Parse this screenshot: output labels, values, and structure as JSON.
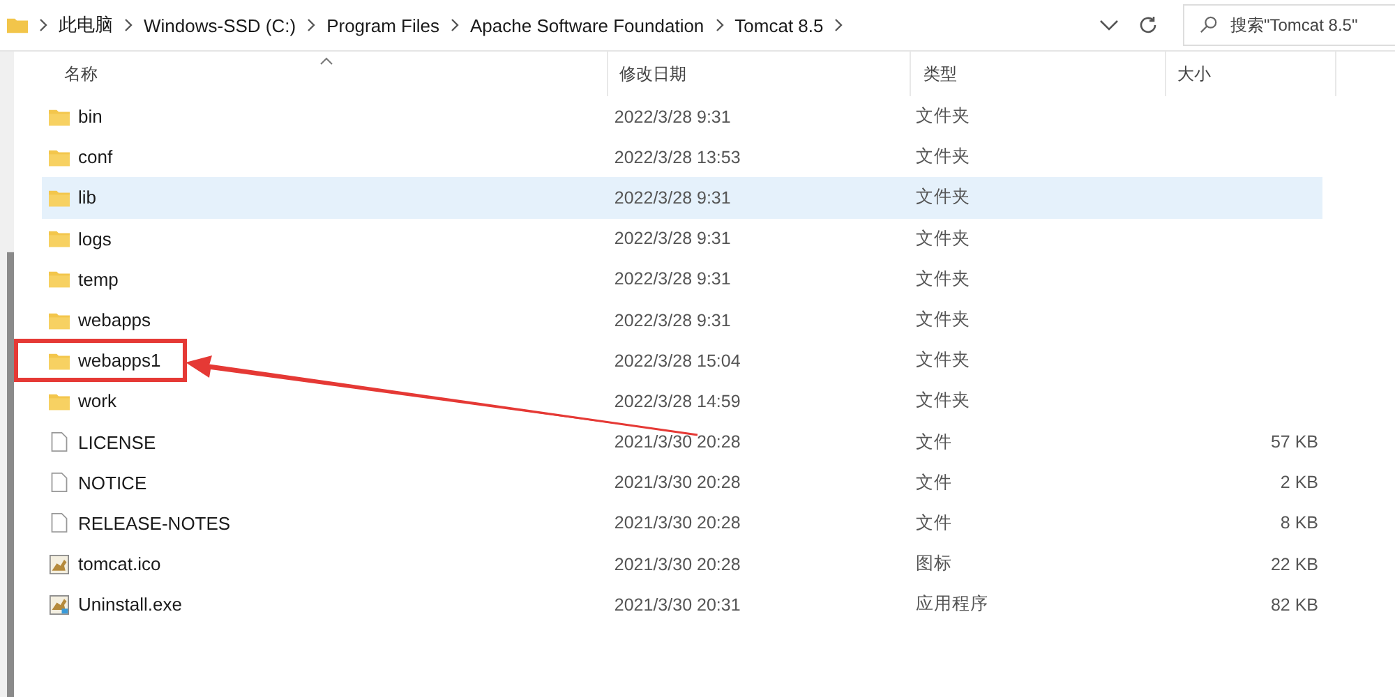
{
  "address_bar": {
    "path": [
      "此电脑",
      "Windows-SSD (C:)",
      "Program Files",
      "Apache Software Foundation",
      "Tomcat 8.5"
    ]
  },
  "search": {
    "placeholder": "搜索\"Tomcat 8.5\""
  },
  "table": {
    "columns": [
      "名称",
      "修改日期",
      "类型",
      "大小"
    ],
    "rows": [
      {
        "kind": "folder",
        "name": "bin",
        "date": "2022/3/28 9:31",
        "type": "文件夹",
        "selected": false,
        "marked": false
      },
      {
        "kind": "folder",
        "name": "conf",
        "date": "2022/3/28 13:53",
        "type": "文件夹",
        "selected": false,
        "marked": false
      },
      {
        "kind": "folder",
        "name": "lib",
        "date": "2022/3/28 9:31",
        "type": "文件夹",
        "selected": true,
        "marked": false
      },
      {
        "kind": "folder",
        "name": "logs",
        "date": "2022/3/28 9:31",
        "type": "文件夹",
        "selected": false,
        "marked": false
      },
      {
        "kind": "folder",
        "name": "temp",
        "date": "2022/3/28 9:31",
        "type": "文件夹",
        "selected": false,
        "marked": false
      },
      {
        "kind": "folder",
        "name": "webapps",
        "date": "2022/3/28 9:31",
        "type": "文件夹",
        "selected": false,
        "marked": false
      },
      {
        "kind": "folder",
        "name": "webapps1",
        "date": "2022/3/28 15:04",
        "type": "文件夹",
        "selected": false,
        "marked": true
      },
      {
        "kind": "folder",
        "name": "work",
        "date": "2022/3/28 14:59",
        "type": "文件夹",
        "selected": false,
        "marked": false
      },
      {
        "kind": "file",
        "name": "LICENSE",
        "date": "2021/3/30 20:28",
        "type": "文件",
        "size": "57 KB",
        "selected": false,
        "marked": false
      },
      {
        "kind": "file",
        "name": "NOTICE",
        "date": "2021/3/30 20:28",
        "type": "文件",
        "size": "2 KB",
        "selected": false,
        "marked": false
      },
      {
        "kind": "file",
        "name": "RELEASE-NOTES",
        "date": "2021/3/30 20:28",
        "type": "文件",
        "size": "8 KB",
        "selected": false,
        "marked": false
      },
      {
        "kind": "icon",
        "name": "tomcat.ico",
        "date": "2021/3/30 20:28",
        "type": "图标",
        "size": "22 KB",
        "selected": false,
        "marked": false
      },
      {
        "kind": "program",
        "name": "Uninstall.exe",
        "date": "2021/3/30 20:31",
        "type": "应用程序",
        "size": "82 KB",
        "selected": false,
        "marked": false
      }
    ]
  }
}
